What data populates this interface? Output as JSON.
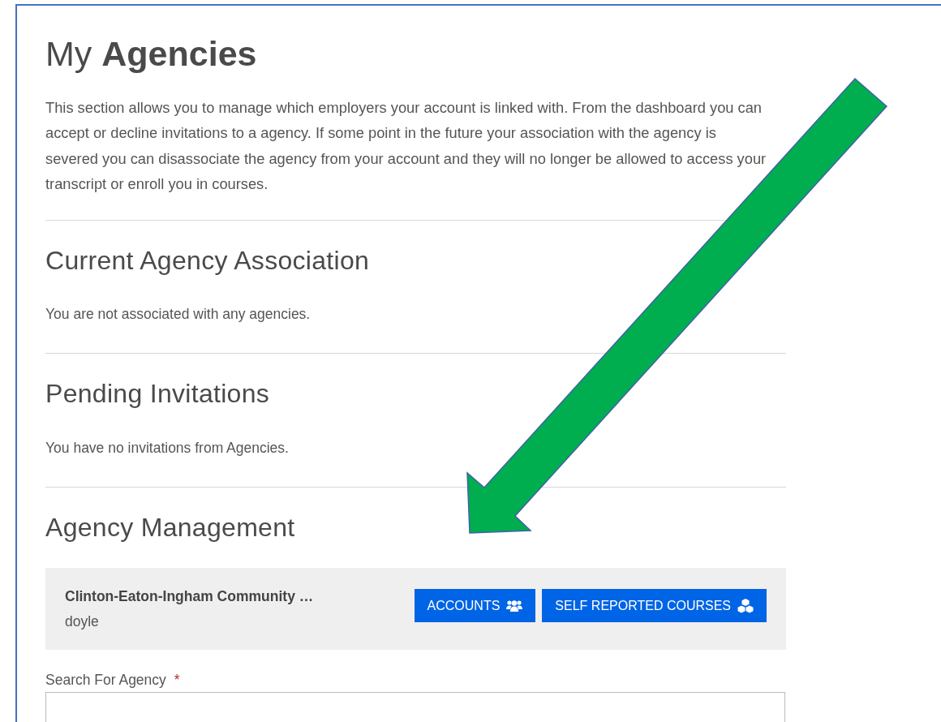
{
  "title": "My **Agencies**",
  "intro": "This section allows you to manage which employers your account is linked with. From the dashboard you can accept or decline invitations to a agency. If some point in the future your association with the agency is severed you can disassociate the agency from your account and they will no longer be allowed to access your transcript or enroll you in courses.",
  "sections": [
    {
      "heading": "Current Agency Association",
      "message": "You are not associated with any agencies."
    },
    {
      "heading": "Pending Invitations",
      "message": "You have no invitations from Agencies."
    }
  ],
  "management": {
    "heading": "Agency Management",
    "agency": {
      "name": "Clinton-Eaton-Ingham Community …",
      "user": "doyle"
    },
    "buttons": [
      {
        "label": "ACCOUNTS"
      },
      {
        "label": "SELF REPORTED COURSES"
      }
    ],
    "search": {
      "label": "Search For Agency",
      "required_marker": "*"
    }
  }
}
